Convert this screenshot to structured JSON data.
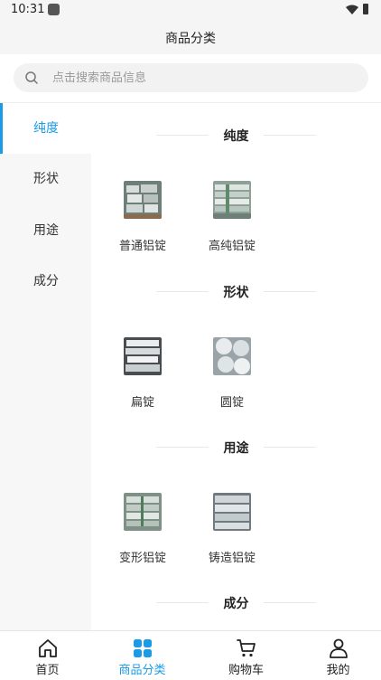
{
  "status": {
    "time": "10:31"
  },
  "header": {
    "title": "商品分类"
  },
  "search": {
    "placeholder": "点击搜索商品信息"
  },
  "sidebar": {
    "items": [
      {
        "label": "纯度",
        "active": true
      },
      {
        "label": "形状",
        "active": false
      },
      {
        "label": "用途",
        "active": false
      },
      {
        "label": "成分",
        "active": false
      }
    ]
  },
  "sections": [
    {
      "title": "纯度",
      "products": [
        {
          "name": "普通铝锭"
        },
        {
          "name": "高纯铝锭"
        }
      ]
    },
    {
      "title": "形状",
      "products": [
        {
          "name": "扁锭"
        },
        {
          "name": "圆锭"
        }
      ]
    },
    {
      "title": "用途",
      "products": [
        {
          "name": "变形铝锭"
        },
        {
          "name": "铸造铝锭"
        }
      ]
    },
    {
      "title": "成分",
      "products": []
    }
  ],
  "tabbar": {
    "items": [
      {
        "label": "首页",
        "icon": "home-icon"
      },
      {
        "label": "商品分类",
        "icon": "category-icon",
        "active": true
      },
      {
        "label": "购物车",
        "icon": "cart-icon"
      },
      {
        "label": "我的",
        "icon": "user-icon"
      }
    ]
  },
  "colors": {
    "accent": "#1a9be8",
    "sidebar_bg": "#f7f7f7",
    "header_bg": "#f5f5f5"
  }
}
